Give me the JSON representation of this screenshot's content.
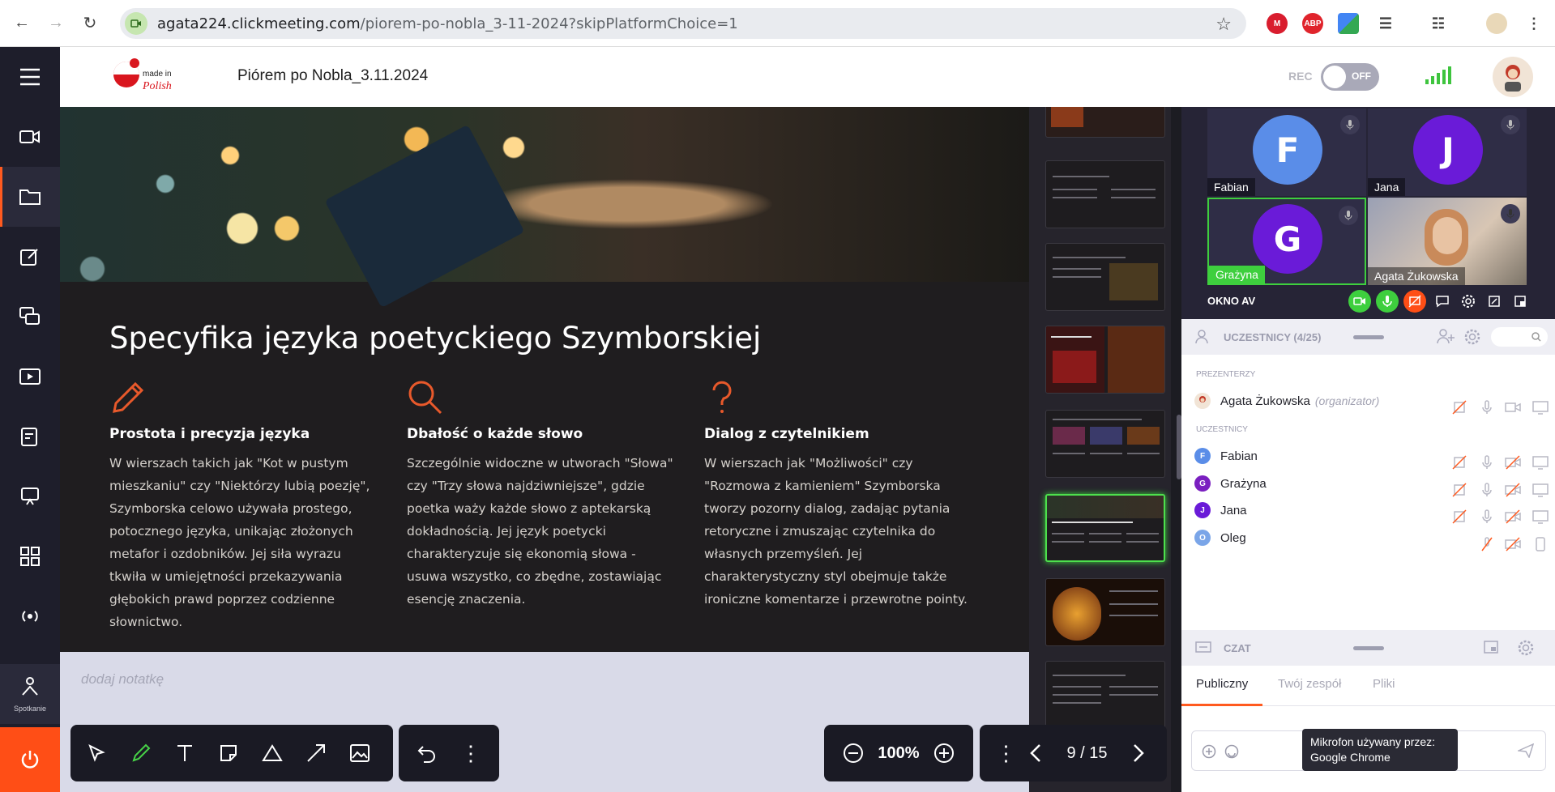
{
  "browser": {
    "url_host": "agata224.clickmeeting.com",
    "url_path": "/piorem-po-nobla_3-11-2024?skipPlatformChoice=1"
  },
  "header": {
    "meeting_title": "Piórem po Nobla_3.11.2024",
    "rec_label": "REC",
    "rec_toggle": "OFF",
    "logo_text_top": "made in",
    "logo_text_bottom": "Polish"
  },
  "sidebar": {
    "bottom_label": "Spotkanie"
  },
  "slide": {
    "title": "Specyfika języka poetyckiego Szymborskiej",
    "columns": [
      {
        "icon": "pencil-icon",
        "heading": "Prostota i precyzja języka",
        "body": "W wierszach takich jak \"Kot w pustym mieszkaniu\" czy \"Niektórzy lubią poezję\", Szymborska celowo używała prostego, potocznego języka, unikając złożonych metafor i ozdobników. Jej siła wyrazu tkwiła w umiejętności przekazywania głębokich prawd poprzez codzienne słownictwo."
      },
      {
        "icon": "magnifier-icon",
        "heading": "Dbałość o każde słowo",
        "body": "Szczególnie widoczne w utworach \"Słowa\" czy \"Trzy słowa najdziwniejsze\", gdzie poetka waży każde słowo z aptekarską dokładnością. Jej język poetycki charakteryzuje się ekonomią słowa - usuwa wszystko, co zbędne, zostawiając esencję znaczenia."
      },
      {
        "icon": "question-icon",
        "heading": "Dialog z czytelnikiem",
        "body": "W wierszach jak \"Możliwości\" czy \"Rozmowa z kamieniem\" Szymborska tworzy pozorny dialog, zadając pytania retoryczne i zmuszając czytelnika do własnych przemyśleń. Jej charakterystyczny styl obejmuje także ironiczne komentarze i przewrotne pointy."
      }
    ]
  },
  "notes": {
    "placeholder": "dodaj notatkę"
  },
  "thumbnails": [
    {
      "title": ""
    },
    {
      "title": "Nagroda Nobla w dziedzinie literatury"
    },
    {
      "title": "Analiza wiersza \"Pewne ciasy po Ludwiku Wawrzyńskiej\""
    },
    {
      "title": "Charakterystyka poezji Szymborskiej"
    },
    {
      "title": "Uniwersalność tematów wierszy Szymborskiej"
    },
    {
      "title": "Specyfika języka poetyckiego Szymborskiej"
    },
    {
      "title": "\"Nic dwa razy\" - analiza wiersza"
    },
    {
      "title": "Rola ironii w twórczości Szymborskiej"
    }
  ],
  "toolbar": {
    "zoom": "100%",
    "page": "9 / 15"
  },
  "video": {
    "tiles": [
      {
        "initial": "F",
        "name": "Fabian",
        "color": "#5a8de8"
      },
      {
        "initial": "J",
        "name": "Jana",
        "color": "#6a1bd8"
      },
      {
        "initial": "G",
        "name": "Grażyna",
        "color": "#6a1bd8"
      },
      {
        "initial": "",
        "name": "Agata Żukowska",
        "color": "#b0a090"
      }
    ],
    "window_label": "OKNO AV"
  },
  "participants": {
    "title": "UCZESTNICY (4/25)",
    "presenters_label": "PREZENTERZY",
    "participants_label": "UCZESTNICY",
    "presenters": [
      {
        "name": "Agata Żukowska",
        "role": "(organizator)"
      }
    ],
    "list": [
      {
        "initial": "F",
        "name": "Fabian",
        "color": "#5a8de8"
      },
      {
        "initial": "G",
        "name": "Grażyna",
        "color": "#7a1fc0"
      },
      {
        "initial": "J",
        "name": "Jana",
        "color": "#6a1bd8"
      },
      {
        "initial": "O",
        "name": "Oleg",
        "color": "#7aa5e8"
      }
    ]
  },
  "chat": {
    "title": "CZAT",
    "tabs": [
      "Publiczny",
      "Twój zespół",
      "Pliki"
    ]
  },
  "tooltip": {
    "line1": "Mikrofon używany przez:",
    "line2": "Google Chrome"
  }
}
